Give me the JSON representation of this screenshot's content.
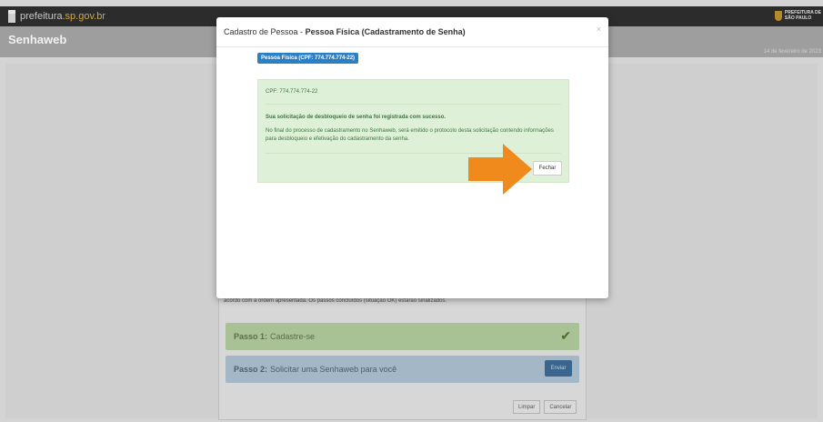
{
  "header": {
    "logo_main": "prefeitura",
    "logo_accent": ".sp.gov.br",
    "pref_line1": "PREFEITURA DE",
    "pref_line2": "SÃO PAULO"
  },
  "app": {
    "title": "Senhaweb",
    "date": "14 de fevereiro de 2023"
  },
  "background": {
    "instructions": "acordo com a ordem apresentada. Os passos concluídos (situação OK) estarão sinalizados.",
    "step1": {
      "label": "Passo 1:",
      "text": "Cadastre-se"
    },
    "step2": {
      "label": "Passo 2:",
      "text": "Solicitar uma Senhaweb para você",
      "button": "Enviar"
    },
    "buttons": {
      "limpar": "Limpar",
      "cancelar": "Cancelar"
    }
  },
  "modal": {
    "title_prefix": "Cadastro de Pessoa - ",
    "title_bold": "Pessoa Física (Cadastramento de Senha)",
    "close": "×",
    "tag": "Pessoa Física (CPF: 774.774.774-22)",
    "cpf_line": "CPF: 774.774.774-22",
    "success_title": "Sua solicitação de desbloqueio de senha foi registrada com sucesso.",
    "success_body": "No final do processo de cadastramento no Senhaweb, será emitido o protocolo desta solicitação contendo informações para desbloqueio e efetivação do cadastramento da senha.",
    "fechar": "Fechar"
  },
  "colors": {
    "arrow": "#f08a1c",
    "tag": "#2d7fc4",
    "success_bg": "#dff0d8"
  },
  "icons": {
    "check": "check-icon",
    "arrow": "arrow-right-icon"
  }
}
